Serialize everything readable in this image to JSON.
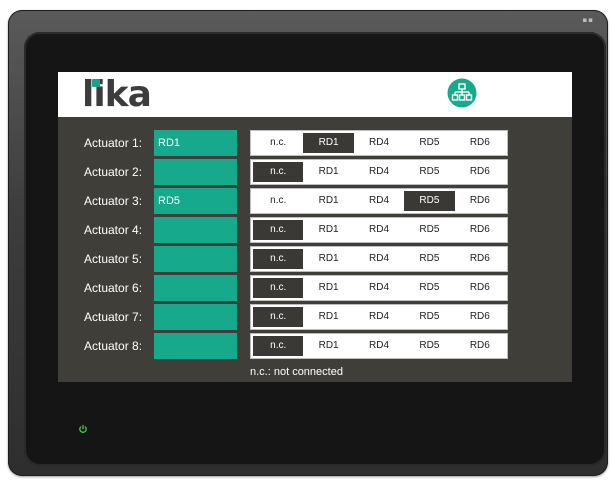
{
  "device": {
    "corner_mark": "▪▪",
    "power_icon": "power-icon"
  },
  "header": {
    "logo_text": "lika",
    "network_icon": "network-icon",
    "colors": {
      "accent": "#17a98c",
      "panel": "#403e39"
    }
  },
  "actuators": [
    {
      "label": "Actuator 1:",
      "value": "RD1",
      "selected": "RD1"
    },
    {
      "label": "Actuator 2:",
      "value": "",
      "selected": "n.c."
    },
    {
      "label": "Actuator 3:",
      "value": "RD5",
      "selected": "RD5"
    },
    {
      "label": "Actuator 4:",
      "value": "",
      "selected": "n.c."
    },
    {
      "label": "Actuator 5:",
      "value": "",
      "selected": "n.c."
    },
    {
      "label": "Actuator 6:",
      "value": "",
      "selected": "n.c."
    },
    {
      "label": "Actuator 7:",
      "value": "",
      "selected": "n.c."
    },
    {
      "label": "Actuator 8:",
      "value": "",
      "selected": "n.c."
    }
  ],
  "options": [
    "n.c.",
    "RD1",
    "RD4",
    "RD5",
    "RD6"
  ],
  "footnote": "n.c.: not connected"
}
